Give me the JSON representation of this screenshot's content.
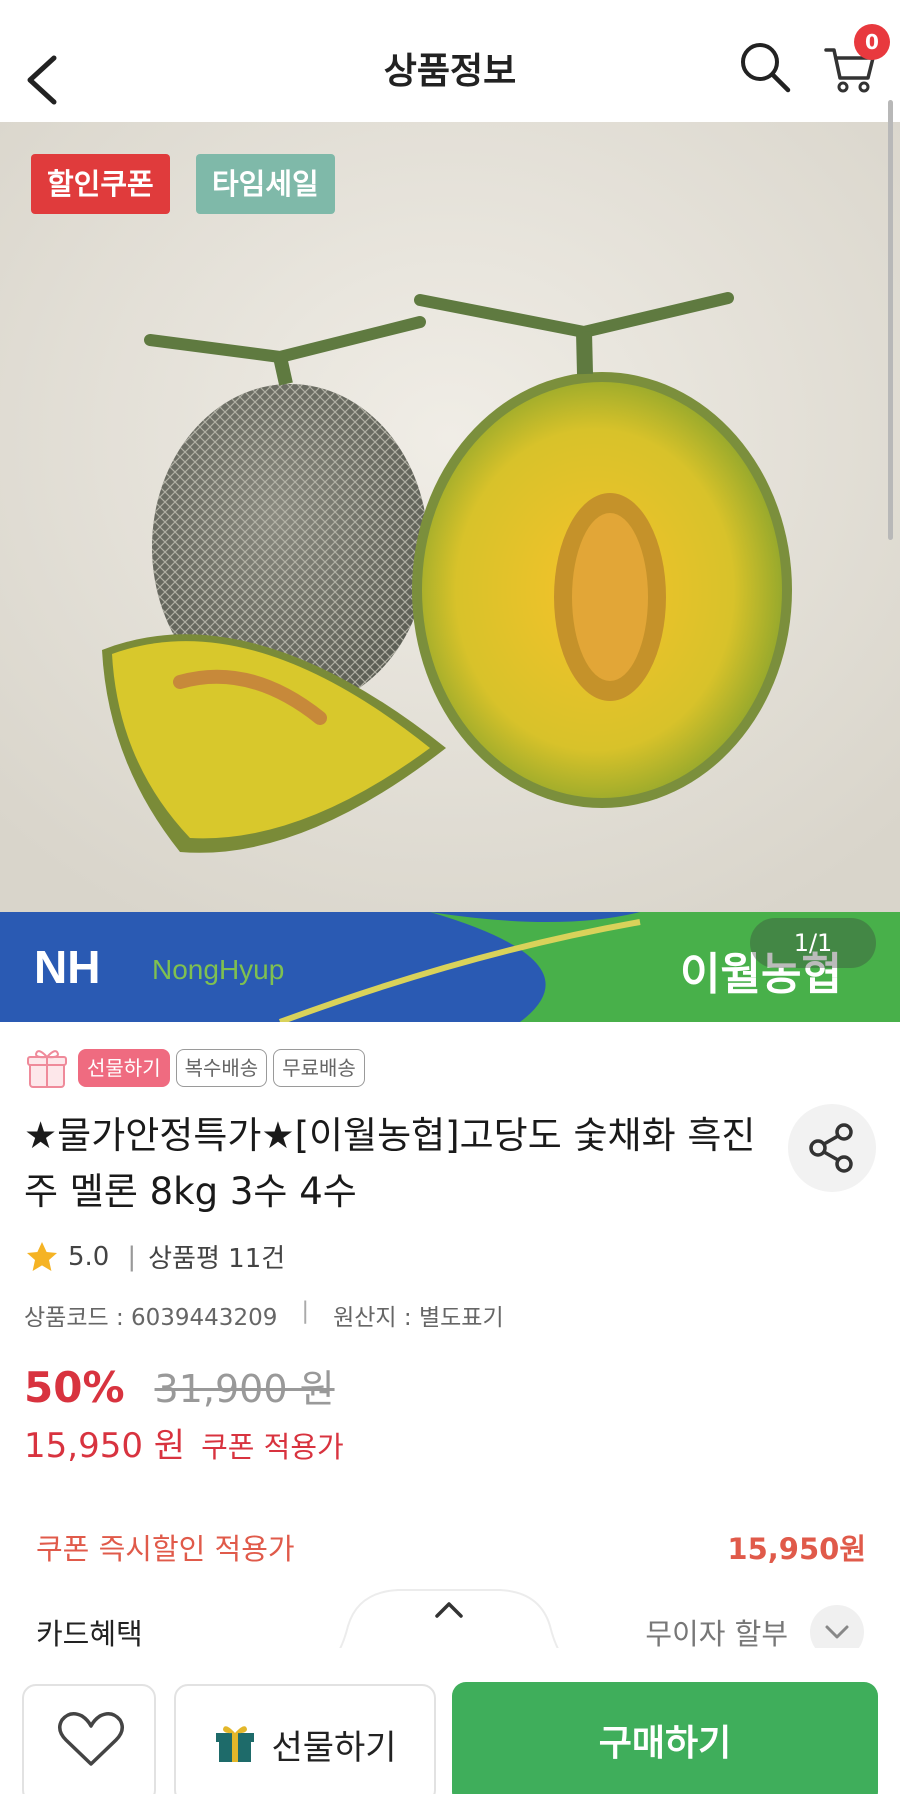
{
  "header": {
    "title": "상품정보",
    "cart_count": "0",
    "icons": [
      "back-arrow-icon",
      "search-icon",
      "cart-icon"
    ]
  },
  "image": {
    "badges": [
      "할인쿠폰",
      "타임세일"
    ],
    "pager": "1/1",
    "banner_left": "NH",
    "banner_left_sub": "NongHyup",
    "banner_right": "이월농협",
    "colors": {
      "coupon_badge": "#e03b3c",
      "time_badge": "#7fb9a9",
      "banner_blue": "#2a5ab3",
      "banner_green": "#48b04a"
    }
  },
  "product": {
    "tags": [
      "선물하기",
      "복수배송",
      "무료배송"
    ],
    "title": "★물가안정특가★[이월농협]고당도 숯채화 흑진주 멜론 8kg 3수 4수",
    "rating": "5.0",
    "review_count": "상품평 11건",
    "product_code": "상품코드 : 6039443209",
    "origin": "원산지 : 별도표기"
  },
  "pricing": {
    "discount": "50%",
    "original_price": "31,900 원",
    "sale_price": "15,950 원",
    "coupon_label": "쿠폰 적용가",
    "instant_label": "쿠폰 즉시할인 적용가",
    "instant_price": "15,950원",
    "card_label": "카드혜택",
    "installment": "무이자 할부",
    "accent": "#d8333f"
  },
  "bottom_bar": {
    "gift_label": "선물하기",
    "buy_label": "구매하기",
    "buy_color": "#3fae5b"
  }
}
